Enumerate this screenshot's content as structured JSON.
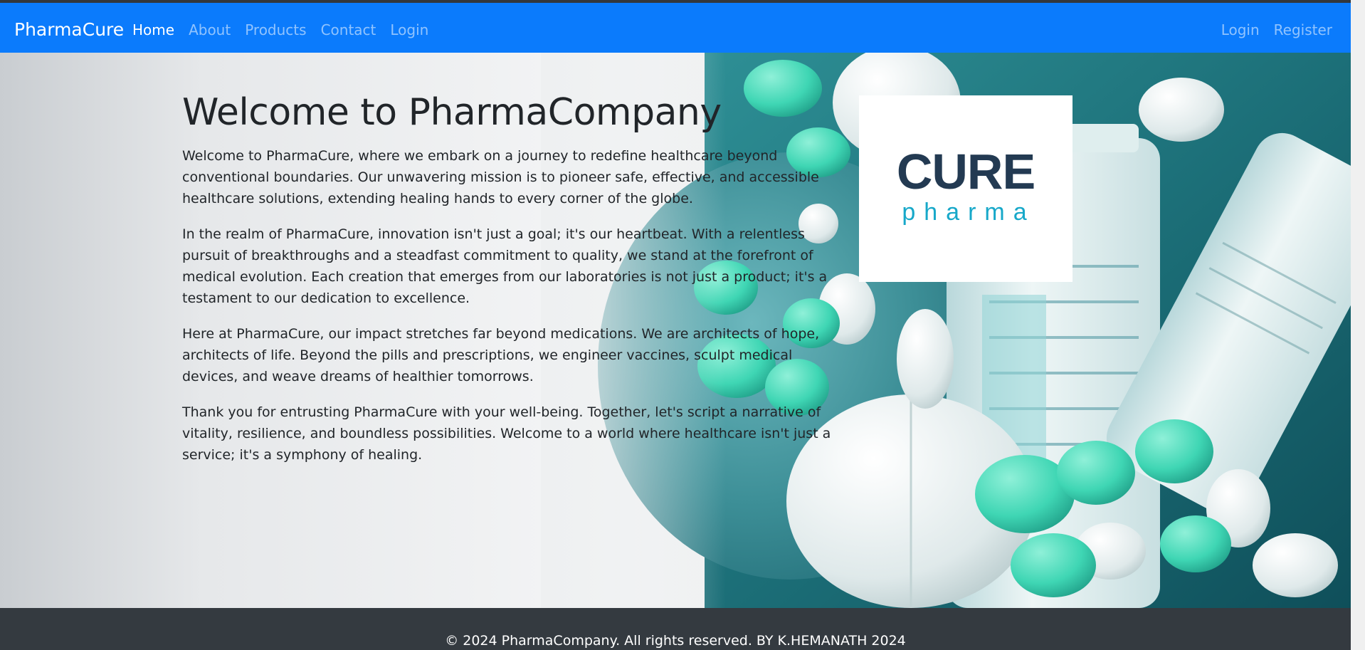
{
  "navbar": {
    "brand": "PharmaCure",
    "links": [
      {
        "label": "Home",
        "active": true
      },
      {
        "label": "About",
        "active": false
      },
      {
        "label": "Products",
        "active": false
      },
      {
        "label": "Contact",
        "active": false
      },
      {
        "label": "Login",
        "active": false
      }
    ],
    "right_links": [
      {
        "label": "Login"
      },
      {
        "label": "Register"
      }
    ]
  },
  "hero": {
    "title": "Welcome to PharmaCompany",
    "paragraphs": [
      "Welcome to PharmaCure, where we embark on a journey to redefine healthcare beyond conventional boundaries. Our unwavering mission is to pioneer safe, effective, and accessible healthcare solutions, extending healing hands to every corner of the globe.",
      "In the realm of PharmaCure, innovation isn't just a goal; it's our heartbeat. With a relentless pursuit of breakthroughs and a steadfast commitment to quality, we stand at the forefront of medical evolution. Each creation that emerges from our laboratories is not just a product; it's a testament to our dedication to excellence.",
      "Here at PharmaCure, our impact stretches far beyond medications. We are architects of hope, architects of life. Beyond the pills and prescriptions, we engineer vaccines, sculpt medical devices, and weave dreams of healthier tomorrows.",
      "Thank you for entrusting PharmaCure with your well-being. Together, let's script a narrative of vitality, resilience, and boundless possibilities. Welcome to a world where healthcare isn't just a service; it's a symphony of healing."
    ],
    "logo": {
      "main": "CURE",
      "sub": "pharma"
    }
  },
  "footer": {
    "text": "© 2024 PharmaCompany. All rights reserved. BY K.HEMANATH 2024"
  },
  "colors": {
    "navbar": "#0b7bfc",
    "footer": "#343a40",
    "logo_dark": "#233a52",
    "logo_teal": "#17a8c9",
    "pill_teal": "#3fd6b4"
  }
}
